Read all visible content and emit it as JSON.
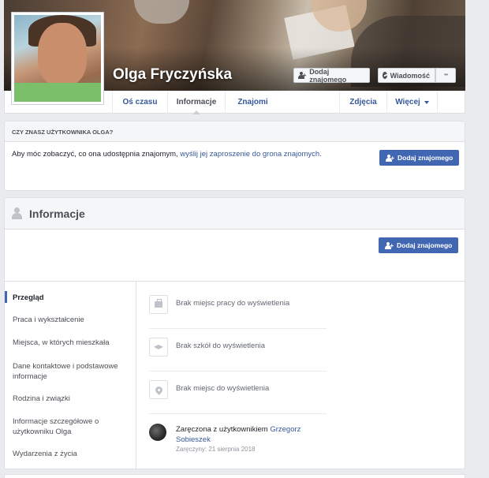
{
  "profile": {
    "name": "Olga Fryczyńska",
    "cover_buttons": {
      "add_friend": "Dodaj znajomego",
      "message": "Wiadomość",
      "more": "•••"
    }
  },
  "nav": {
    "tabs": [
      {
        "label": "Oś czasu"
      },
      {
        "label": "Informacje"
      },
      {
        "label": "Znajomi"
      },
      {
        "label": "Zdjęcia"
      },
      {
        "label": "Więcej"
      }
    ],
    "active_tab": "Informacje"
  },
  "know_card": {
    "heading": "CZY ZNASZ UŻYTKOWNIKA OLGA?",
    "text_before": "Aby móc zobaczyć, co ona udostępnia znajomym, ",
    "link": "wyślij jej zaproszenie do grona znajomych.",
    "button": "Dodaj znajomego"
  },
  "info_card": {
    "title": "Informacje",
    "button": "Dodaj znajomego",
    "sidebar": [
      {
        "label": "Przegląd"
      },
      {
        "label": "Praca i wykształcenie"
      },
      {
        "label": "Miejsca, w których mieszkała"
      },
      {
        "label": "Dane kontaktowe i podstawowe informacje"
      },
      {
        "label": "Rodzina i związki"
      },
      {
        "label": "Informacje szczegółowe o użytkowniku Olga"
      },
      {
        "label": "Wydarzenia z życia"
      }
    ],
    "entries": [
      {
        "icon": "briefcase-icon",
        "text": "Brak miejsc pracy do wyświetlenia"
      },
      {
        "icon": "graduation-cap-icon",
        "text": "Brak szkół do wyświetlenia"
      },
      {
        "icon": "location-pin-icon",
        "text": "Brak miejsc do wyświetlenia"
      }
    ],
    "engagement": {
      "prefix": "Zaręczona z użytkownikiem ",
      "partner": "Grzegorz Sobieszek",
      "date": "Zaręczyny: 21 sierpnia 2018"
    }
  },
  "colors": {
    "primary_blue": "#4267b2",
    "link_blue": "#365899",
    "page_bg": "#e9ebee"
  }
}
